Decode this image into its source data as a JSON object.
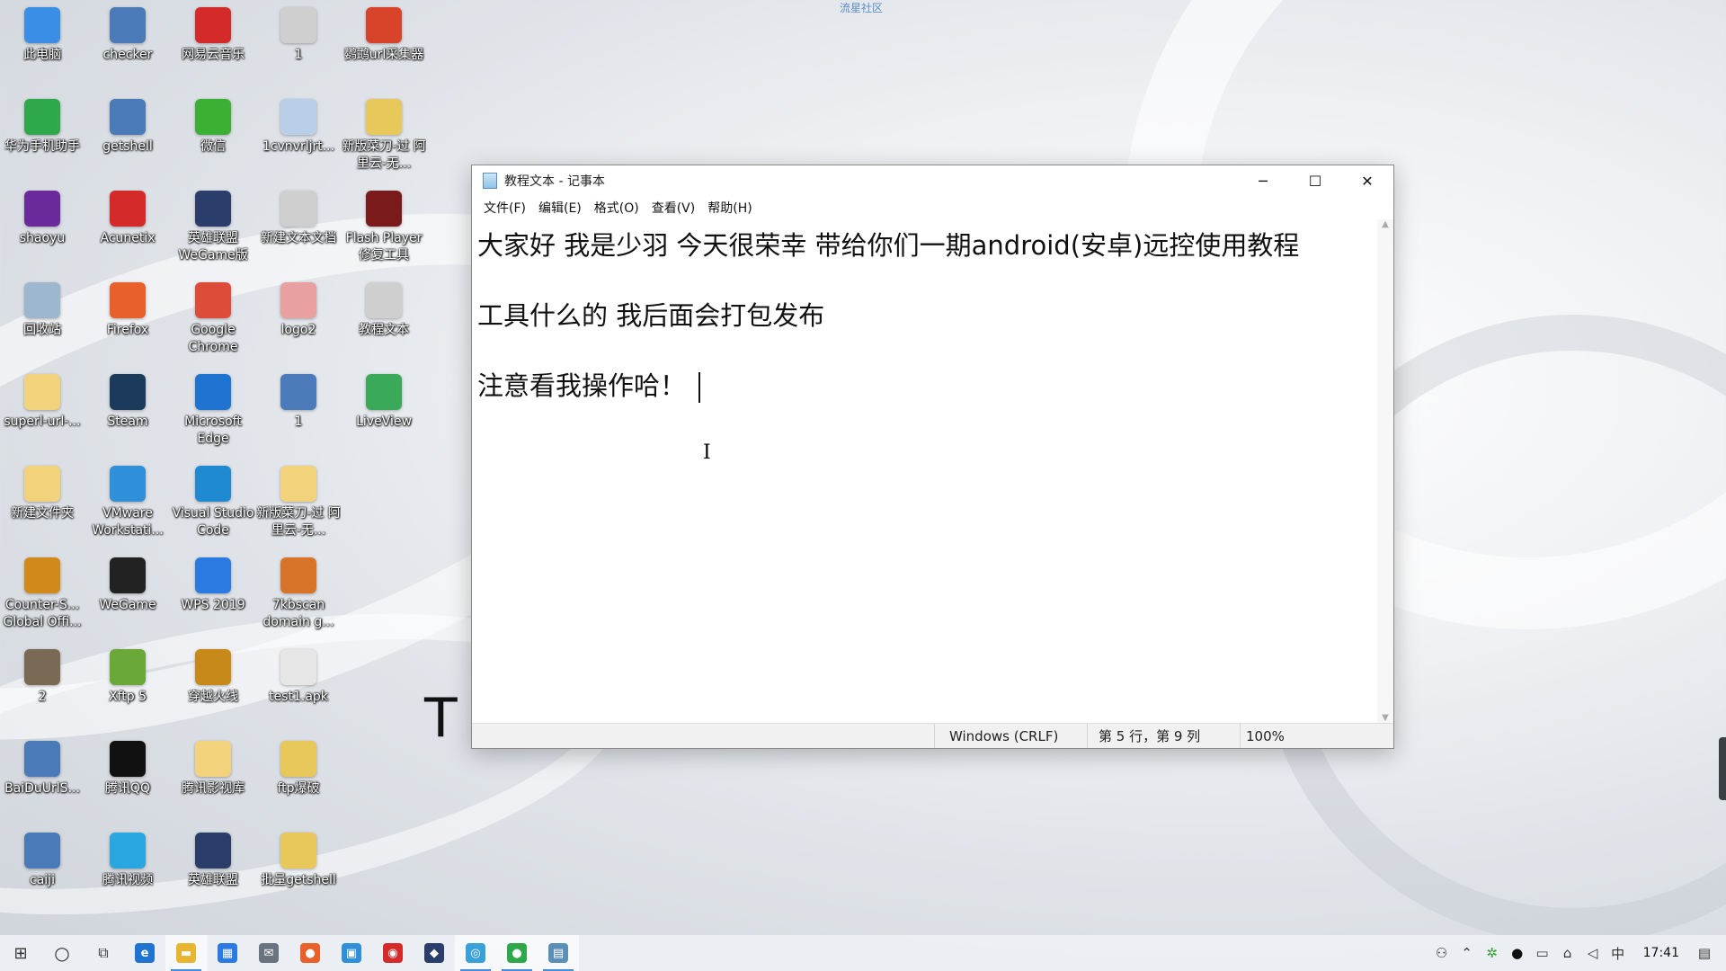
{
  "watermark": "流星社区",
  "desktop_icons": [
    {
      "label": "此电脑",
      "icon": "computer-icon",
      "color": "#3a8ee6"
    },
    {
      "label": "华为手机助手",
      "icon": "huawei-icon",
      "color": "#2ea84a"
    },
    {
      "label": "shaoyu",
      "icon": "firefox-dark-icon",
      "color": "#6b2a9b"
    },
    {
      "label": "回收站",
      "icon": "recycle-bin-icon",
      "color": "#9db7cf"
    },
    {
      "label": "superl-url-...",
      "icon": "folder-icon",
      "color": "#f2d27a"
    },
    {
      "label": "新建文件夹",
      "icon": "folder-icon",
      "color": "#f2d27a"
    },
    {
      "label": "Counter-S... Global Offi...",
      "icon": "csgo-icon",
      "color": "#d18a1a"
    },
    {
      "label": "2",
      "icon": "image-file-icon",
      "color": "#7a6a55"
    },
    {
      "label": "BaiDuUrlS...",
      "icon": "python-file-icon",
      "color": "#4a7ab8"
    },
    {
      "label": "caiji",
      "icon": "python-file-icon",
      "color": "#4a7ab8"
    },
    {
      "label": "checker",
      "icon": "python-file-icon",
      "color": "#4a7ab8"
    },
    {
      "label": "getshell",
      "icon": "python-file-icon",
      "color": "#4a7ab8"
    },
    {
      "label": "Acunetix",
      "icon": "acunetix-icon",
      "color": "#d42a2a"
    },
    {
      "label": "Firefox",
      "icon": "firefox-icon",
      "color": "#e8602a"
    },
    {
      "label": "Steam",
      "icon": "steam-icon",
      "color": "#1b3a5c"
    },
    {
      "label": "VMware Workstati...",
      "icon": "vmware-icon",
      "color": "#2f8fd8"
    },
    {
      "label": "WeGame",
      "icon": "wegame-icon",
      "color": "#222222"
    },
    {
      "label": "Xftp 5",
      "icon": "xftp-icon",
      "color": "#6aa83a"
    },
    {
      "label": "腾讯QQ",
      "icon": "qq-icon",
      "color": "#111111"
    },
    {
      "label": "腾讯视频",
      "icon": "tencent-video-icon",
      "color": "#2aa6e0"
    },
    {
      "label": "网易云音乐",
      "icon": "netease-music-icon",
      "color": "#d42a2a"
    },
    {
      "label": "微信",
      "icon": "wechat-icon",
      "color": "#3cb034"
    },
    {
      "label": "英雄联盟 WeGame版",
      "icon": "lol-icon",
      "color": "#2b3d6b"
    },
    {
      "label": "Google Chrome",
      "icon": "chrome-icon",
      "color": "#dd4b39"
    },
    {
      "label": "Microsoft Edge",
      "icon": "edge-icon",
      "color": "#1e74d0"
    },
    {
      "label": "Visual Studio Code",
      "icon": "vscode-icon",
      "color": "#1f8ad2"
    },
    {
      "label": "WPS 2019",
      "icon": "wps-icon",
      "color": "#2a7ae2"
    },
    {
      "label": "穿越火线",
      "icon": "crossfire-icon",
      "color": "#c78a1a"
    },
    {
      "label": "腾讯影视库",
      "icon": "folder-icon",
      "color": "#f2d27a"
    },
    {
      "label": "英雄联盟",
      "icon": "lol-icon",
      "color": "#2b3d6b"
    },
    {
      "label": "1",
      "icon": "text-file-icon",
      "color": "#cfcfcf"
    },
    {
      "label": "1cvnvrljrt...",
      "icon": "jpg-file-icon",
      "color": "#b9cfe8"
    },
    {
      "label": "新建文本文档",
      "icon": "text-file-icon",
      "color": "#cfcfcf"
    },
    {
      "label": "logo2",
      "icon": "image-file-icon",
      "color": "#e8a0a0"
    },
    {
      "label": "1",
      "icon": "python-file-icon",
      "color": "#4a7ab8"
    },
    {
      "label": "新版菜刀-过 阿里云-无...",
      "icon": "folder-icon",
      "color": "#f2d27a"
    },
    {
      "label": "7kbscan domain g...",
      "icon": "7kbscan-icon",
      "color": "#d8742a"
    },
    {
      "label": "test1.apk",
      "icon": "apk-file-icon",
      "color": "#e6e6e6"
    },
    {
      "label": "ftp爆破",
      "icon": "zip-folder-icon",
      "color": "#e8c85a"
    },
    {
      "label": "批量getshell",
      "icon": "zip-folder-icon",
      "color": "#e8c85a"
    },
    {
      "label": "鹦鹉url采集器",
      "icon": "parrot-icon",
      "color": "#d8442a"
    },
    {
      "label": "新版菜刀-过 阿里云-无...",
      "icon": "zip-folder-icon",
      "color": "#e8c85a"
    },
    {
      "label": "Flash Player 修复工具",
      "icon": "flash-icon",
      "color": "#7a1a1a"
    },
    {
      "label": "教程文本",
      "icon": "text-file-icon",
      "color": "#cfcfcf"
    },
    {
      "label": "LiveView",
      "icon": "liveview-icon",
      "color": "#3aaa5a"
    }
  ],
  "notepad": {
    "title": "教程文本 - 记事本",
    "menu": [
      "文件(F)",
      "编辑(E)",
      "格式(O)",
      "查看(V)",
      "帮助(H)"
    ],
    "lines": [
      "大家好 我是少羽 今天很荣幸 带给你们一期android(安卓)远控使用教程",
      "",
      "工具什么的 我后面会打包发布",
      "",
      "注意看我操作哈！"
    ],
    "status": {
      "encoding": "Windows (CRLF)",
      "position": "第 5 行，第 9 列",
      "zoom": "100%"
    }
  },
  "taskbar": {
    "apps": [
      {
        "name": "edge-taskbar-icon",
        "glyph": "e",
        "color": "#1e74d0"
      },
      {
        "name": "explorer-taskbar-icon",
        "glyph": "▬",
        "color": "#e8b530"
      },
      {
        "name": "store-taskbar-icon",
        "glyph": "▦",
        "color": "#2a7ae2"
      },
      {
        "name": "mail-taskbar-icon",
        "glyph": "✉",
        "color": "#6a7480"
      },
      {
        "name": "firefox-taskbar-icon",
        "glyph": "●",
        "color": "#e8602a"
      },
      {
        "name": "vmware-taskbar-icon",
        "glyph": "▣",
        "color": "#2f8fd8"
      },
      {
        "name": "netease-taskbar-icon",
        "glyph": "◉",
        "color": "#d42a2a"
      },
      {
        "name": "lol-taskbar-icon",
        "glyph": "◆",
        "color": "#2b3d6b"
      },
      {
        "name": "search-app-taskbar-icon",
        "glyph": "◎",
        "color": "#3aa0d8"
      },
      {
        "name": "huawei-taskbar-icon",
        "glyph": "●",
        "color": "#2ea84a"
      },
      {
        "name": "notepad-taskbar-icon",
        "glyph": "▤",
        "color": "#5c8fb6"
      }
    ],
    "ime": "中",
    "time": "17:41"
  }
}
